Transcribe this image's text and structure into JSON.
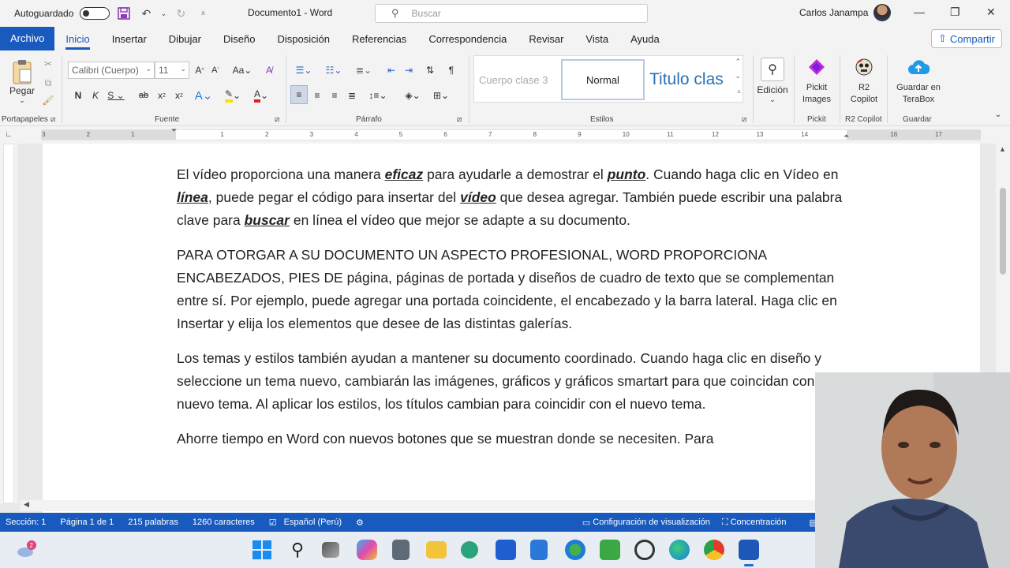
{
  "titlebar": {
    "autosave_label": "Autoguardado",
    "document_title": "Documento1  -  Word",
    "search_placeholder": "Buscar",
    "user_name": "Carlos Janampa",
    "minimize": "—",
    "restore": "❐",
    "close": "✕"
  },
  "menu": {
    "archivo": "Archivo",
    "tabs": [
      "Inicio",
      "Insertar",
      "Dibujar",
      "Diseño",
      "Disposición",
      "Referencias",
      "Correspondencia",
      "Revisar",
      "Vista",
      "Ayuda"
    ],
    "active_tab": "Inicio",
    "share": "Compartir"
  },
  "ribbon": {
    "paste": "Pegar",
    "font_name": "Calibri (Cuerpo)",
    "font_size": "11",
    "styles": [
      "Cuerpo clase 3",
      "Normal",
      "Titulo clas"
    ],
    "edicion": "Edición",
    "pickit": "Pickit Images",
    "r2copilot": "R2 Copilot",
    "terabox": "Guardar en TeraBox",
    "groups": {
      "portapapeles": "Portapapeles",
      "fuente": "Fuente",
      "parrafo": "Párrafo",
      "estilos": "Estilos",
      "pickit": "Pickit",
      "r2copilot": "R2 Copilot",
      "guardar": "Guardar"
    }
  },
  "ruler_numbers": [
    "3",
    "2",
    "1",
    "",
    "1",
    "2",
    "3",
    "4",
    "5",
    "6",
    "7",
    "8",
    "9",
    "10",
    "11",
    "12",
    "13",
    "14",
    "",
    "16",
    "17"
  ],
  "document": {
    "p1": [
      {
        "t": "El vídeo proporciona una manera ",
        "b": false
      },
      {
        "t": "eficaz",
        "b": true
      },
      {
        "t": " para ayudarle a demostrar el ",
        "b": false
      },
      {
        "t": "punto",
        "b": true
      },
      {
        "t": ". Cuando haga clic en Vídeo en ",
        "b": false
      },
      {
        "t": "línea",
        "b": true
      },
      {
        "t": ", puede pegar el código para insertar del ",
        "b": false
      },
      {
        "t": "vídeo",
        "b": true
      },
      {
        "t": " que desea agregar. También puede escribir una palabra clave para ",
        "b": false
      },
      {
        "t": "buscar",
        "b": true
      },
      {
        "t": " en línea el vídeo que mejor se adapte a su documento.",
        "b": false
      }
    ],
    "p2": "PARA OTORGAR A SU DOCUMENTO UN ASPECTO PROFESIONAL, WORD PROPORCIONA ENCABEZADOS, PIES DE página, páginas de portada y diseños de cuadro de texto que se complementan entre sí. Por ejemplo, puede agregar una portada coincidente, el encabezado y la barra lateral. Haga clic en Insertar y elija los elementos que desee de las distintas galerías.",
    "p3": "Los temas y estilos también ayudan a mantener su documento coordinado. Cuando haga clic en diseño y seleccione un tema nuevo, cambiarán las imágenes, gráficos y gráficos smartart para que coincidan con el nuevo tema. Al aplicar los estilos, los títulos cambian para coincidir con el nuevo tema.",
    "p4": "Ahorre tiempo en Word con nuevos botones que se muestran donde se necesiten. Para"
  },
  "statusbar": {
    "section": "Sección: 1",
    "page": "Página 1 de 1",
    "words": "215 palabras",
    "chars": "1260 caracteres",
    "language": "Español (Perú)",
    "display_settings": "Configuración de visualización",
    "focus": "Concentración"
  },
  "colors": {
    "accent": "#185abd"
  }
}
